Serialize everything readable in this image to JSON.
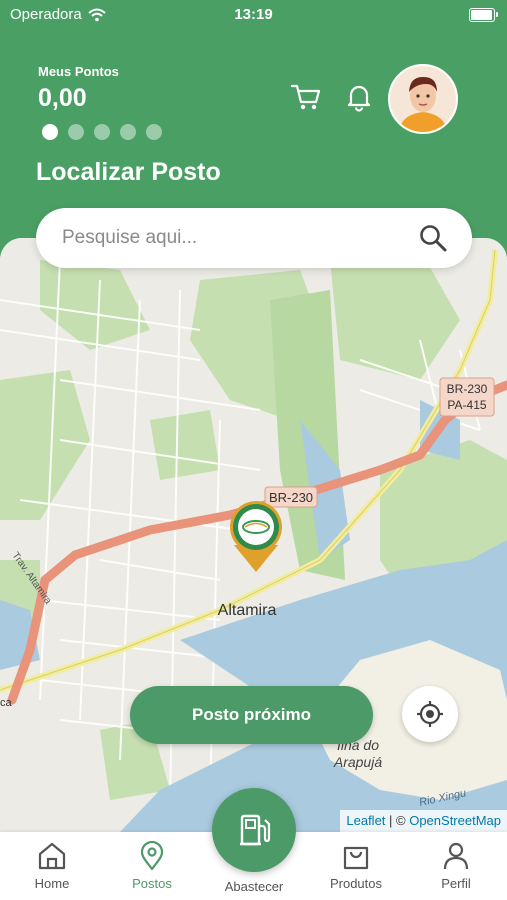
{
  "status_bar": {
    "carrier": "Operadora",
    "time": "13:19"
  },
  "header": {
    "points_label": "Meus Pontos",
    "points_value": "0,00",
    "carousel_dots": 5,
    "carousel_active": 0,
    "title": "Localizar Posto",
    "icons": [
      "cart-icon",
      "bell-icon",
      "avatar"
    ]
  },
  "search": {
    "placeholder": "Pesquise aqui..."
  },
  "map": {
    "labels": {
      "city": "Altamira",
      "road_br230": "BR-230",
      "road_br230_pa415_line1": "BR-230",
      "road_br230_pa415_line2": "PA-415",
      "island_line1": "Ilha do",
      "island_line2": "Arapujá",
      "river": "Rio Xingu",
      "street": "Trav. Altamira",
      "road_edge": "ca"
    },
    "attribution": {
      "leaflet": "Leaflet",
      "separator": " | © ",
      "osm": "OpenStreetMap"
    }
  },
  "actions": {
    "nearest_button": "Posto próximo"
  },
  "bottom_nav": {
    "items": [
      {
        "label": "Home",
        "icon": "home-icon"
      },
      {
        "label": "Postos",
        "icon": "location-pin-icon",
        "active": true
      },
      {
        "label": "Abastecer",
        "icon": "fuel-pump-icon"
      },
      {
        "label": "Produtos",
        "icon": "shopping-bag-icon"
      },
      {
        "label": "Perfil",
        "icon": "user-icon"
      }
    ]
  },
  "colors": {
    "brand_green": "#4c9a68",
    "header_green": "#4aa064",
    "road": "#e8937a",
    "water": "#aacbdf",
    "park": "#c6dfb0"
  }
}
